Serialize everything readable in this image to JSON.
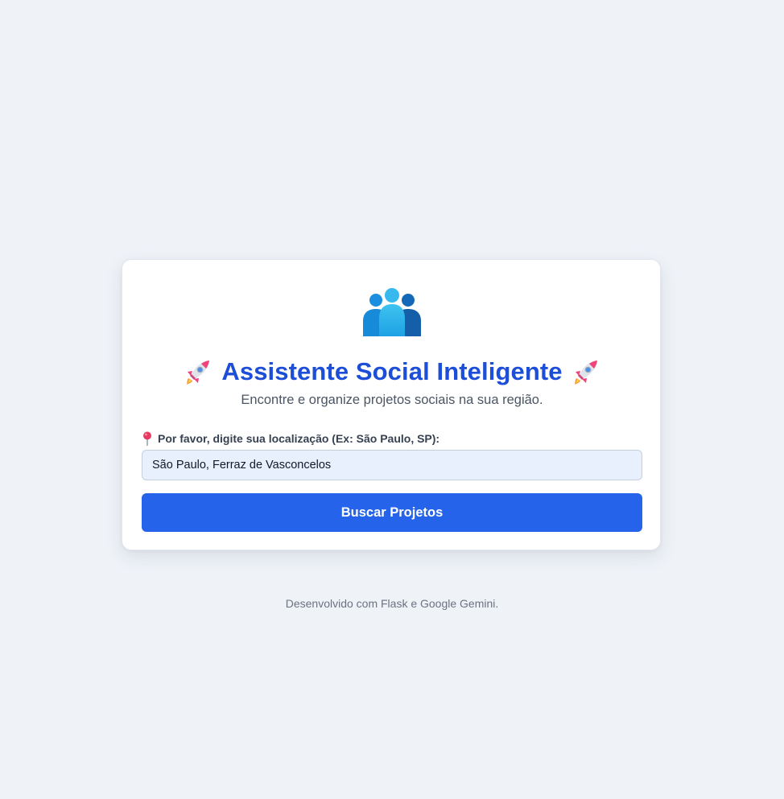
{
  "card": {
    "logo_icon": "people-group-icon",
    "title_icon": "rocket-icon",
    "title": "Assistente Social Inteligente",
    "subtitle": "Encontre e organize projetos sociais na sua região.",
    "location_icon": "location-pin-icon",
    "location_label": "Por favor, digite sua localização (Ex: São Paulo, SP):",
    "location_value": "São Paulo, Ferraz de Vasconcelos",
    "search_button": "Buscar Projetos"
  },
  "footer": {
    "text": "Desenvolvido com Flask e Google Gemini."
  },
  "colors": {
    "background": "#eff3f8",
    "title": "#1d4ed8",
    "button": "#2563eb",
    "input_background": "#e8f0fe"
  }
}
